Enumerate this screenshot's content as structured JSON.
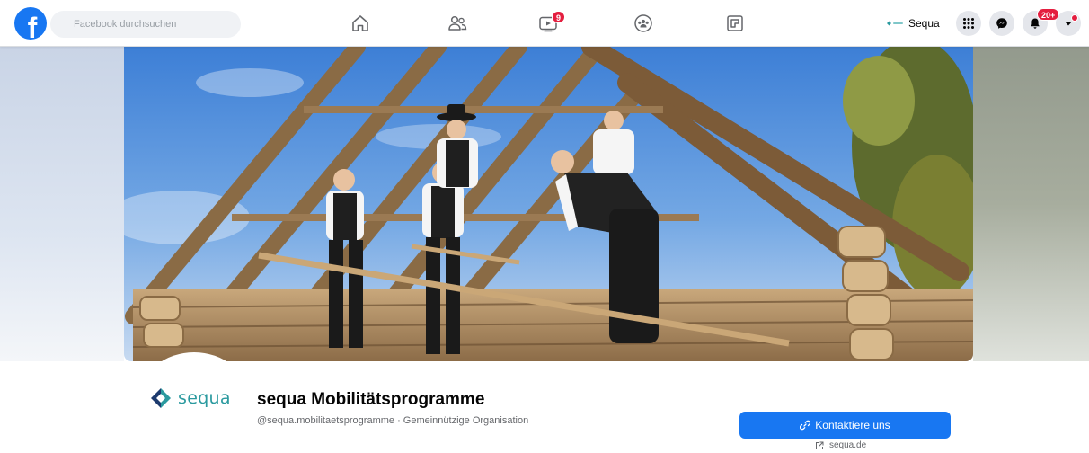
{
  "topbar": {
    "logo_letter": "f",
    "search_placeholder": "Facebook durchsuchen",
    "watch_badge": "9",
    "profile_name": "Sequa",
    "notifications_badge": "20+"
  },
  "brand": {
    "logo_text": "sequa"
  },
  "page": {
    "title": "sequa Mobilitätsprogramme",
    "subtitle": "@sequa.mobilitaetsprogramme · Gemeinnützige Organisation",
    "contact_label": "Kontaktiere uns",
    "website": "sequa.de"
  },
  "colors": {
    "primary": "#1877f2",
    "badge": "#e41e3f",
    "brand_teal": "#2b9a9f",
    "brand_navy": "#1d3b6e"
  },
  "icons": {
    "home": "home-icon",
    "friends": "friends-icon",
    "watch": "video-icon",
    "groups": "groups-icon",
    "gaming": "gaming-icon",
    "menu": "grid-menu-icon",
    "messenger": "messenger-icon",
    "notifications": "bell-icon",
    "account": "chevron-down-icon",
    "search": "search-icon",
    "link": "link-icon",
    "external": "external-link-icon"
  }
}
